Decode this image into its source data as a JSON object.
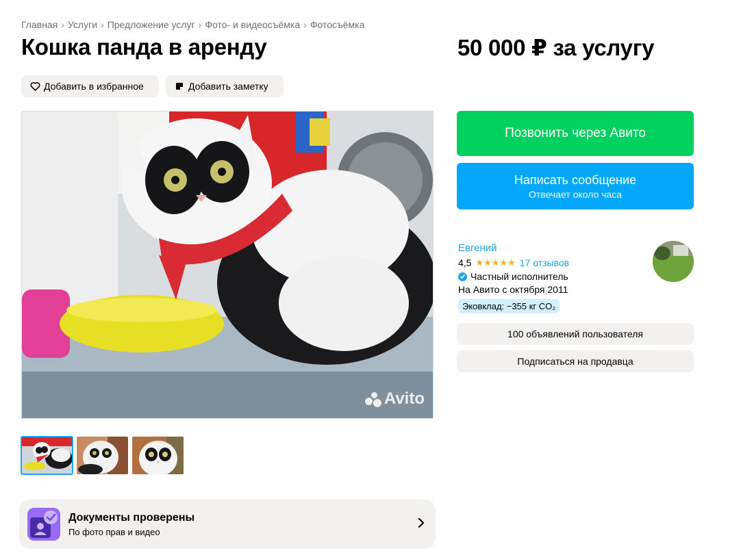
{
  "breadcrumbs": [
    "Главная",
    "Услуги",
    "Предложение услуг",
    "Фото- и видеосъёмка",
    "Фотосъёмка"
  ],
  "breadcrumb_separator": "›",
  "title": "Кошка панда в аренду",
  "price": "50 000 ₽ за услугу",
  "actions": {
    "favorite_label": "Добавить в избранное",
    "favorite_icon": "heart-icon",
    "note_label": "Добавить заметку",
    "note_icon": "note-icon"
  },
  "gallery": {
    "watermark": "Avito",
    "thumbnail_count": 3,
    "active_thumbnail": 1
  },
  "documents": {
    "title": "Документы проверены",
    "subtitle": "По фото прав и видео"
  },
  "contact": {
    "call_label": "Позвонить через Авито",
    "message_label": "Написать сообщение",
    "message_sub": "Отвечает около часа"
  },
  "seller": {
    "name": "Евгений",
    "rating": "4,5",
    "rating_value": 4.5,
    "stars": "★★★★★",
    "reviews": "17 отзывов",
    "type": "Частный исполнитель",
    "since": "На Авито с октября 2011",
    "eco": "Эковклад: −355 кг CO₂",
    "ads_button": "100 объявлений пользователя",
    "subscribe_button": "Подписаться на продавца"
  },
  "colors": {
    "call": "#03d15f",
    "message": "#04a8fb",
    "link": "#1ea4f0",
    "star": "#ffb021",
    "chip_bg": "#f2f1f0"
  }
}
